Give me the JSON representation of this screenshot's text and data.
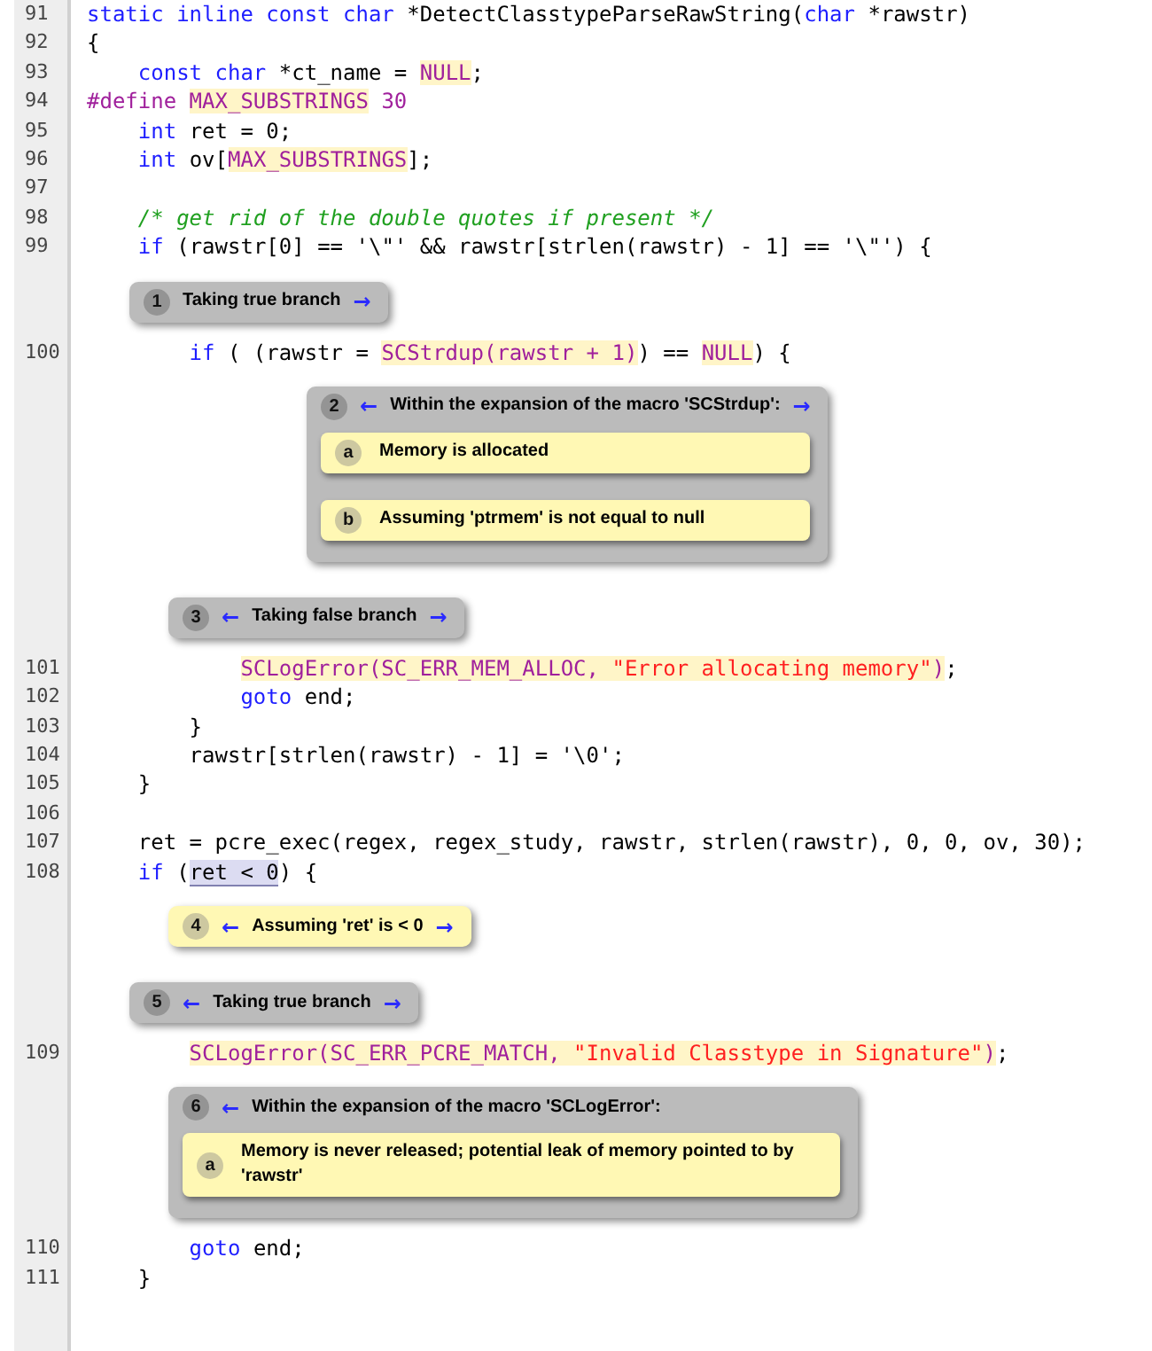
{
  "rows": [
    {
      "kind": "code",
      "number": "91",
      "tokens": [
        {
          "text": "static inline const char",
          "kind": "kw"
        },
        {
          "text": " *DetectClasstypeParseRawString(",
          "kind": "plain"
        },
        {
          "text": "char",
          "kind": "kw"
        },
        {
          "text": " *rawstr)",
          "kind": "plain"
        }
      ]
    },
    {
      "kind": "code",
      "number": "92",
      "tokens": [
        {
          "text": "{",
          "kind": "plain"
        }
      ]
    },
    {
      "kind": "code",
      "number": "93",
      "tokens": [
        {
          "text": "    const char",
          "kind": "kw"
        },
        {
          "text": " *ct_name = ",
          "kind": "plain"
        },
        {
          "text": "NULL",
          "kind": "macro-use"
        },
        {
          "text": ";",
          "kind": "plain"
        }
      ]
    },
    {
      "kind": "code",
      "number": "94",
      "tokens": [
        {
          "text": "#define ",
          "kind": "macro"
        },
        {
          "text": "MAX_SUBSTRINGS",
          "kind": "macro-use"
        },
        {
          "text": " 30",
          "kind": "macro"
        }
      ]
    },
    {
      "kind": "code",
      "number": "95",
      "tokens": [
        {
          "text": "    int",
          "kind": "kw"
        },
        {
          "text": " ret = 0;",
          "kind": "plain"
        }
      ]
    },
    {
      "kind": "code",
      "number": "96",
      "tokens": [
        {
          "text": "    int",
          "kind": "kw"
        },
        {
          "text": " ov[",
          "kind": "plain"
        },
        {
          "text": "MAX_SUBSTRINGS",
          "kind": "macro-use"
        },
        {
          "text": "];",
          "kind": "plain"
        }
      ]
    },
    {
      "kind": "code",
      "number": "97",
      "tokens": []
    },
    {
      "kind": "code",
      "number": "98",
      "tokens": [
        {
          "text": "    /* get rid of the double quotes if present */",
          "kind": "comment"
        }
      ]
    },
    {
      "kind": "code",
      "number": "99",
      "tokens": [
        {
          "text": "    if",
          "kind": "kw"
        },
        {
          "text": " (rawstr[0] == '\\\"' && rawstr[strlen(rawstr) - 1] == '\\\"') {",
          "kind": "plain"
        }
      ]
    },
    {
      "kind": "control-note",
      "number": "1",
      "text": "Taking true branch",
      "next": "→"
    },
    {
      "kind": "code",
      "number": "100",
      "tokens": [
        {
          "text": "        if",
          "kind": "kw"
        },
        {
          "text": " ( (rawstr = ",
          "kind": "plain"
        },
        {
          "text": "SCStrdup(rawstr + 1)",
          "kind": "macro-use"
        },
        {
          "text": ") == ",
          "kind": "plain"
        },
        {
          "text": "NULL",
          "kind": "macro-use"
        },
        {
          "text": ") {",
          "kind": "plain"
        }
      ]
    },
    {
      "kind": "macro-note",
      "number": "2",
      "prev": "←",
      "text": "Within the expansion of the macro 'SCStrdup':",
      "next": "→",
      "children": [
        {
          "letter": "a",
          "text": "Memory is allocated"
        },
        {
          "letter": "b",
          "text": "Assuming 'ptrmem' is not equal to null"
        }
      ]
    },
    {
      "kind": "control-note",
      "number": "3",
      "prev": "←",
      "text": "Taking false branch",
      "next": "→"
    },
    {
      "kind": "code",
      "number": "101",
      "tokens": [
        {
          "text": "            SCLogError(SC_ERR_MEM_ALLOC, ",
          "kind": "macro-use"
        },
        {
          "text": "\"Error allocating memory\"",
          "kind": "string-in-macro"
        },
        {
          "text": ")",
          "kind": "macro-use"
        },
        {
          "text": ";",
          "kind": "plain"
        }
      ]
    },
    {
      "kind": "code",
      "number": "102",
      "tokens": [
        {
          "text": "            goto",
          "kind": "kw"
        },
        {
          "text": " end;",
          "kind": "plain"
        }
      ]
    },
    {
      "kind": "code",
      "number": "103",
      "tokens": [
        {
          "text": "        }",
          "kind": "plain"
        }
      ]
    },
    {
      "kind": "code",
      "number": "104",
      "tokens": [
        {
          "text": "        rawstr[strlen(rawstr) - 1] = '\\0';",
          "kind": "plain"
        }
      ]
    },
    {
      "kind": "code",
      "number": "105",
      "tokens": [
        {
          "text": "    }",
          "kind": "plain"
        }
      ]
    },
    {
      "kind": "code",
      "number": "106",
      "tokens": []
    },
    {
      "kind": "code",
      "number": "107",
      "tokens": [
        {
          "text": "    ret = pcre_exec(regex, regex_study, rawstr, strlen(rawstr), 0, 0, ov, 30);",
          "kind": "plain"
        }
      ]
    },
    {
      "kind": "code",
      "number": "108",
      "tokens": [
        {
          "text": "    if",
          "kind": "kw"
        },
        {
          "text": " (",
          "kind": "plain"
        },
        {
          "text": "ret < 0",
          "kind": "range"
        },
        {
          "text": ") {",
          "kind": "plain"
        }
      ]
    },
    {
      "kind": "event-note",
      "number": "4",
      "prev": "←",
      "text": "Assuming 'ret' is < 0",
      "next": "→"
    },
    {
      "kind": "control-note",
      "number": "5",
      "prev": "←",
      "text": "Taking true branch",
      "next": "→"
    },
    {
      "kind": "code",
      "number": "109",
      "tokens": [
        {
          "text": "        SCLogError(SC_ERR_PCRE_MATCH, ",
          "kind": "macro-use"
        },
        {
          "text": "\"Invalid Classtype in Signature\"",
          "kind": "string-in-macro"
        },
        {
          "text": ")",
          "kind": "macro-use"
        },
        {
          "text": ";",
          "kind": "plain"
        }
      ]
    },
    {
      "kind": "macro-note",
      "number": "6",
      "prev": "←",
      "text": "Within the expansion of the macro 'SCLogError':",
      "children": [
        {
          "letter": "a",
          "text": "Memory is never released; potential leak of memory pointed to by 'rawstr'"
        }
      ]
    },
    {
      "kind": "code",
      "number": "110",
      "tokens": [
        {
          "text": "        goto",
          "kind": "kw"
        },
        {
          "text": " end;",
          "kind": "plain"
        }
      ]
    },
    {
      "kind": "code",
      "number": "111",
      "tokens": [
        {
          "text": "    }",
          "kind": "plain"
        }
      ]
    }
  ]
}
